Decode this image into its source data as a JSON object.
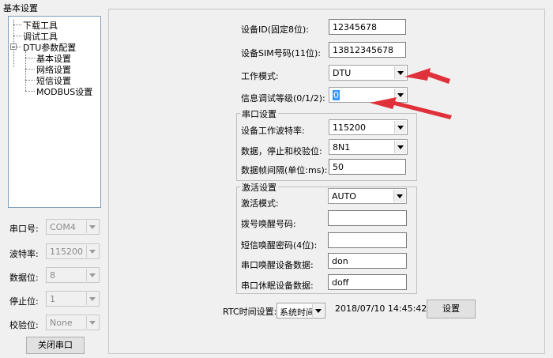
{
  "left_panel": {
    "title": "基本设置",
    "tree": {
      "items": [
        {
          "label": "下载工具"
        },
        {
          "label": "调试工具"
        },
        {
          "label": "DTU参数配置"
        },
        {
          "label": "基本设置"
        },
        {
          "label": "网络设置"
        },
        {
          "label": "短信设置"
        },
        {
          "label": "MODBUS设置"
        }
      ]
    },
    "serial": {
      "port_label": "串口号:",
      "port_value": "COM4",
      "baud_label": "波特率:",
      "baud_value": "115200",
      "data_label": "数据位:",
      "data_value": "8",
      "stop_label": "停止位:",
      "stop_value": "1",
      "parity_label": "校验位:",
      "parity_value": "None",
      "close_button": "关闭串口"
    }
  },
  "main": {
    "device_id_label": "设备ID(固定8位):",
    "device_id_value": "12345678",
    "sim_label": "设备SIM号码(11位):",
    "sim_value": "13812345678",
    "mode_label": "工作模式:",
    "mode_value": "DTU",
    "debug_level_label": "信息调试等级(0/1/2):",
    "debug_level_value": "0",
    "serial_group": {
      "title": "串口设置",
      "baud_label": "设备工作波特率:",
      "baud_value": "115200",
      "format_label": "数据，停止和校验位:",
      "format_value": "8N1",
      "interval_label": "数据帧间隔(单位:ms):",
      "interval_value": "50"
    },
    "activate_group": {
      "title": "激活设置",
      "mode_label": "激活模式:",
      "mode_value": "AUTO",
      "dial_label": "拨号唤醒号码:",
      "dial_value": "",
      "sms_label": "短信唤醒密码(4位):",
      "sms_value": "",
      "wake_label": "串口唤醒设备数据:",
      "wake_value": "don",
      "sleep_label": "串口休眠设备数据:",
      "sleep_value": "doff"
    },
    "rtc": {
      "label": "RTC时间设置:",
      "select_value": "系统时间",
      "datetime": "2018/07/10 14:45:42",
      "set_button": "设置"
    }
  },
  "annotation_colors": {
    "arrow": "#e0313a"
  }
}
